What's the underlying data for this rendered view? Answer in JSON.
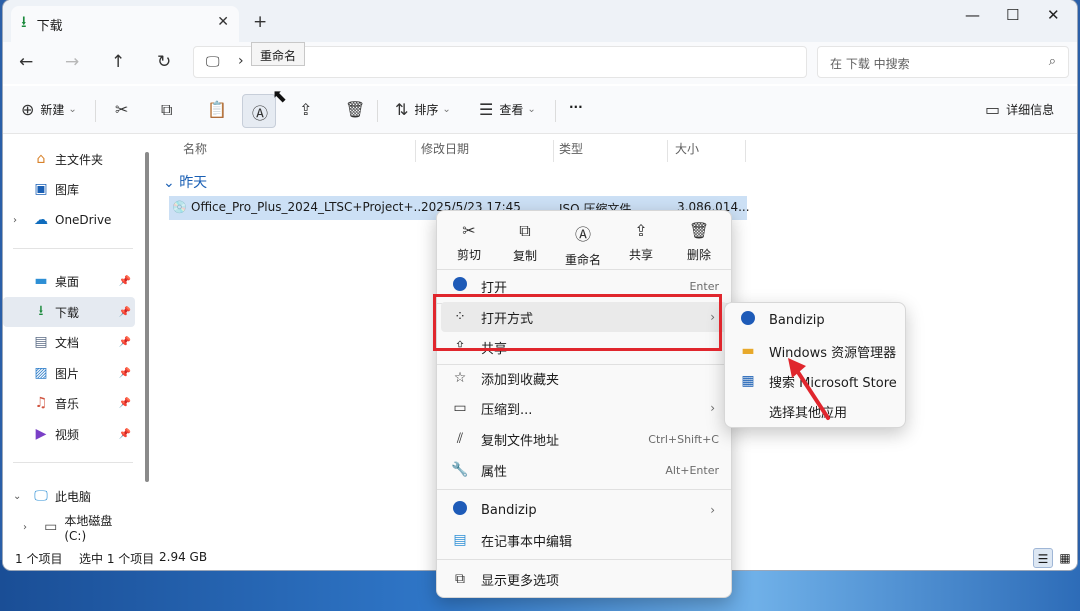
{
  "window": {
    "tab_title": "下载",
    "new_tab": "+"
  },
  "nav": {
    "tooltip": "重命名",
    "search_placeholder": "在 下载 中搜索"
  },
  "commandbar": {
    "new_label": "新建",
    "sort_label": "排序",
    "view_label": "查看",
    "more_label": "···",
    "details_label": "详细信息"
  },
  "sidebar": {
    "items": [
      {
        "label": "主文件夹",
        "icon": "home-icon"
      },
      {
        "label": "图库",
        "icon": "gallery-icon"
      },
      {
        "label": "OneDrive",
        "icon": "cloud-icon"
      },
      {
        "label": "桌面",
        "icon": "desktop-icon"
      },
      {
        "label": "下载",
        "icon": "download-icon"
      },
      {
        "label": "文档",
        "icon": "document-icon"
      },
      {
        "label": "图片",
        "icon": "picture-icon"
      },
      {
        "label": "音乐",
        "icon": "music-icon"
      },
      {
        "label": "视频",
        "icon": "video-icon"
      },
      {
        "label": "此电脑",
        "icon": "pc-icon"
      },
      {
        "label": "本地磁盘 (C:)",
        "icon": "drive-icon"
      }
    ]
  },
  "filelist": {
    "columns": [
      "名称",
      "修改日期",
      "类型",
      "大小"
    ],
    "group": "昨天",
    "file": {
      "name": "Office_Pro_Plus_2024_LTSC+Project+...",
      "date": "2025/5/23 17:45",
      "type": "ISO 压缩文件",
      "size": "3,086,014..."
    }
  },
  "status": {
    "count": "1 个项目",
    "selected": "选中 1 个项目",
    "size": "2.94 GB"
  },
  "context_menu": {
    "quick_actions": [
      "剪切",
      "复制",
      "重命名",
      "共享",
      "删除"
    ],
    "items": [
      {
        "label": "打开",
        "shortcut": "Enter"
      },
      {
        "label": "打开方式"
      },
      {
        "label": "共享"
      },
      {
        "label": "添加到收藏夹"
      },
      {
        "label": "压缩到..."
      },
      {
        "label": "复制文件地址",
        "shortcut": "Ctrl+Shift+C"
      },
      {
        "label": "属性",
        "shortcut": "Alt+Enter"
      },
      {
        "label": "Bandizip"
      },
      {
        "label": "在记事本中编辑"
      },
      {
        "label": "显示更多选项"
      }
    ]
  },
  "submenu": {
    "items": [
      "Bandizip",
      "Windows 资源管理器",
      "搜索 Microsoft Store",
      "选择其他应用"
    ]
  },
  "colors": {
    "accent": "#1a5fb4",
    "selection": "#cce0f5",
    "annotation": "#e0262d"
  }
}
